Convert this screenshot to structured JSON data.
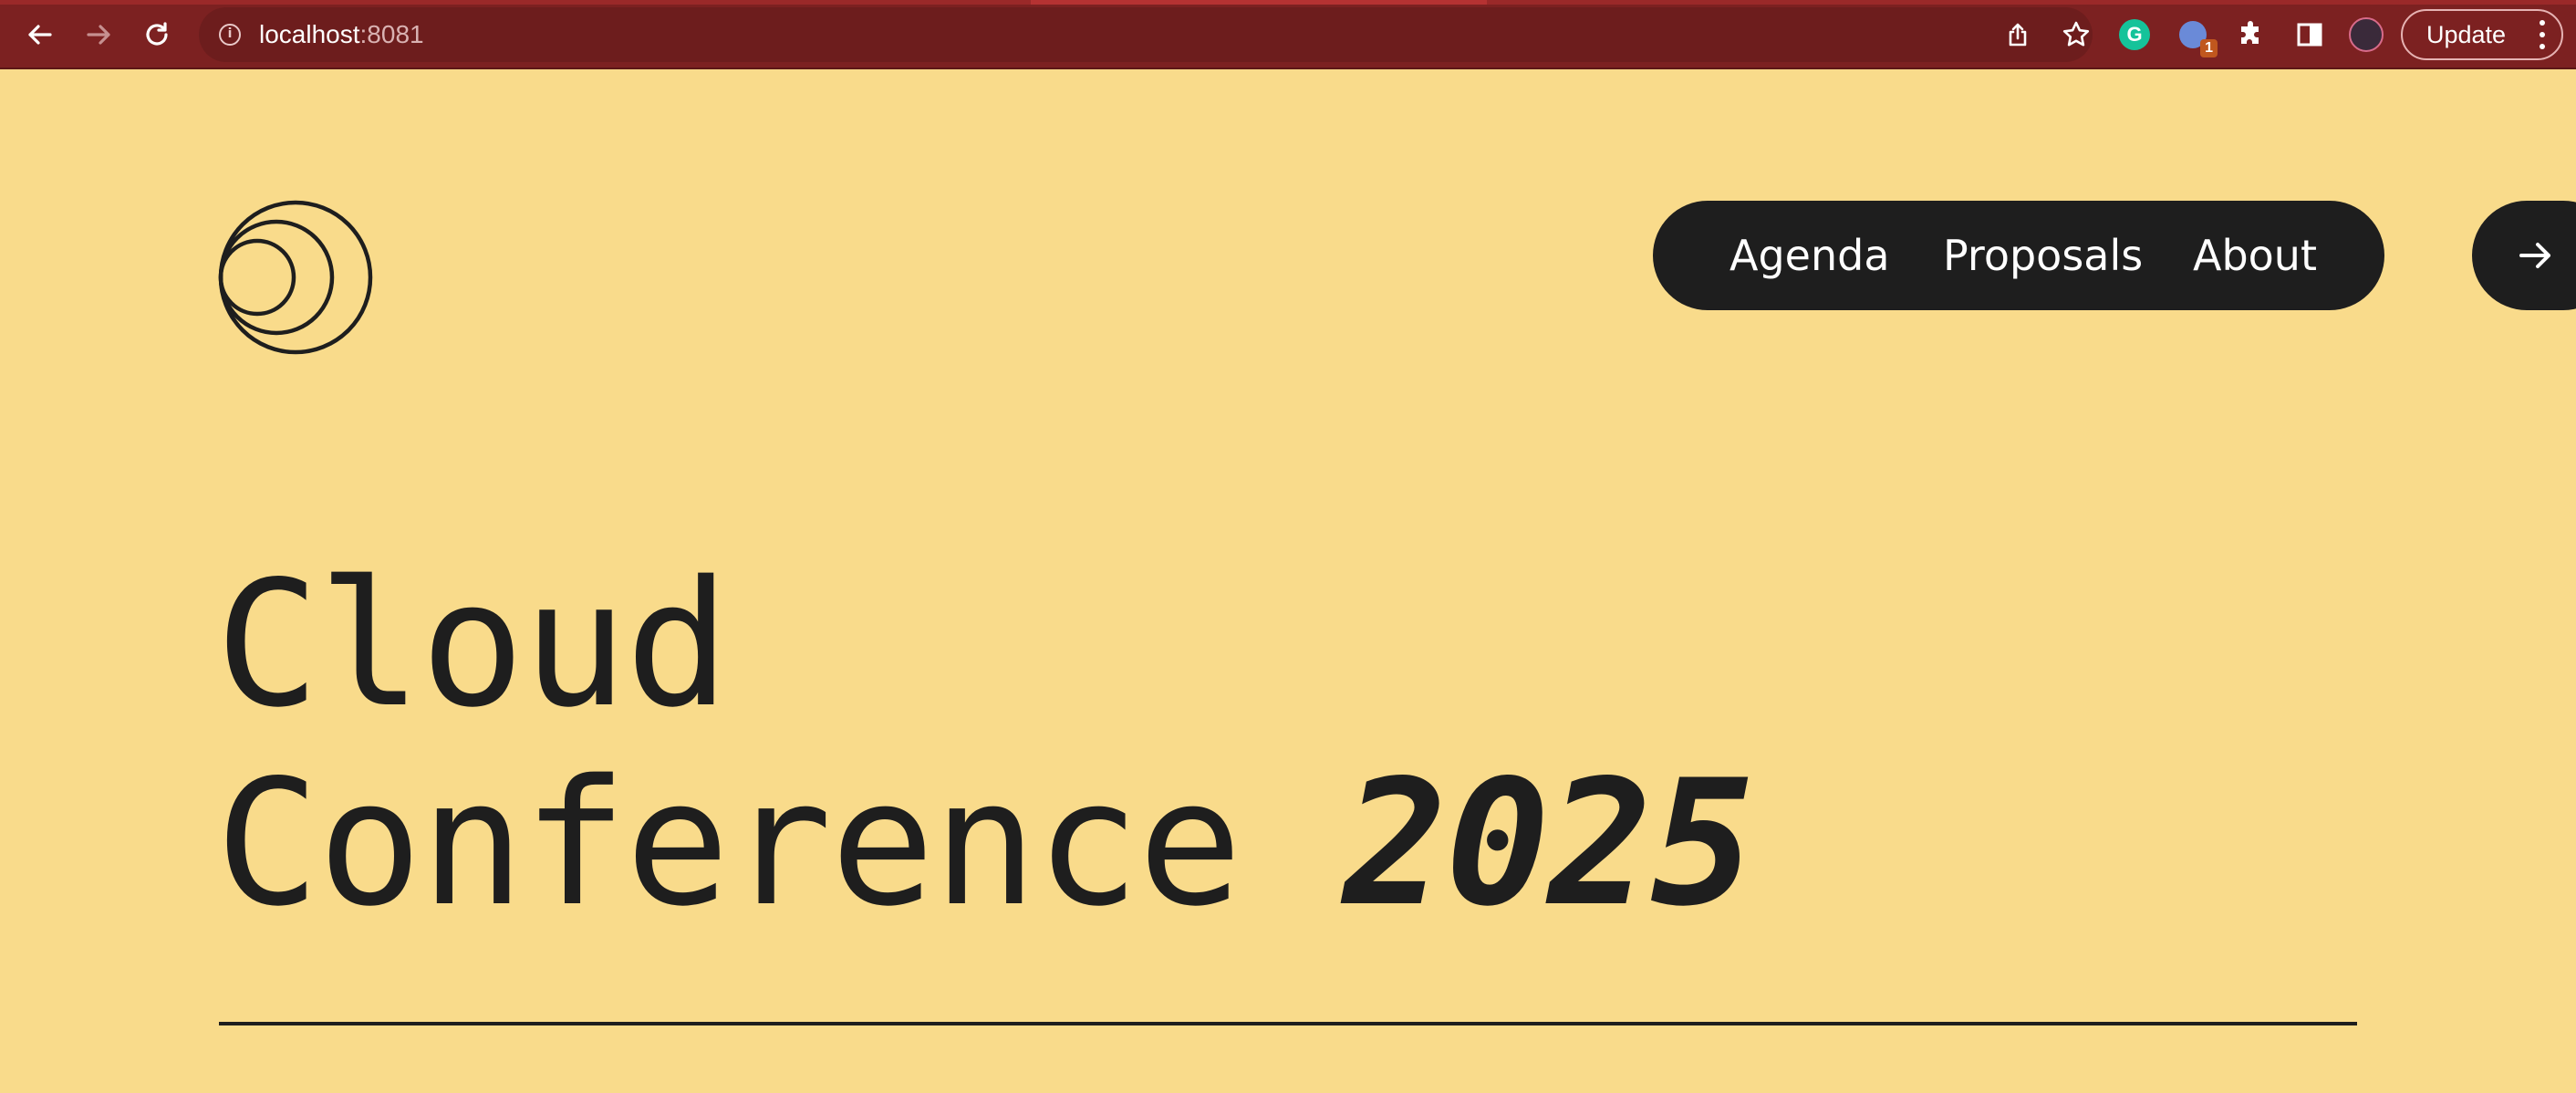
{
  "browser": {
    "url_host": "localhost",
    "url_port": ":8081",
    "extension_badge": "1",
    "update_label": "Update",
    "grammarly_letter": "G"
  },
  "nav": {
    "items": [
      {
        "label": "Agenda"
      },
      {
        "label": "Proposals"
      },
      {
        "label": "About"
      }
    ]
  },
  "hero": {
    "line1": "Cloud",
    "line2": "Conference",
    "year": "2025"
  },
  "colors": {
    "page_background": "#f9db8b",
    "ink": "#1e1e1e",
    "browser_chrome": "#7c2121"
  }
}
